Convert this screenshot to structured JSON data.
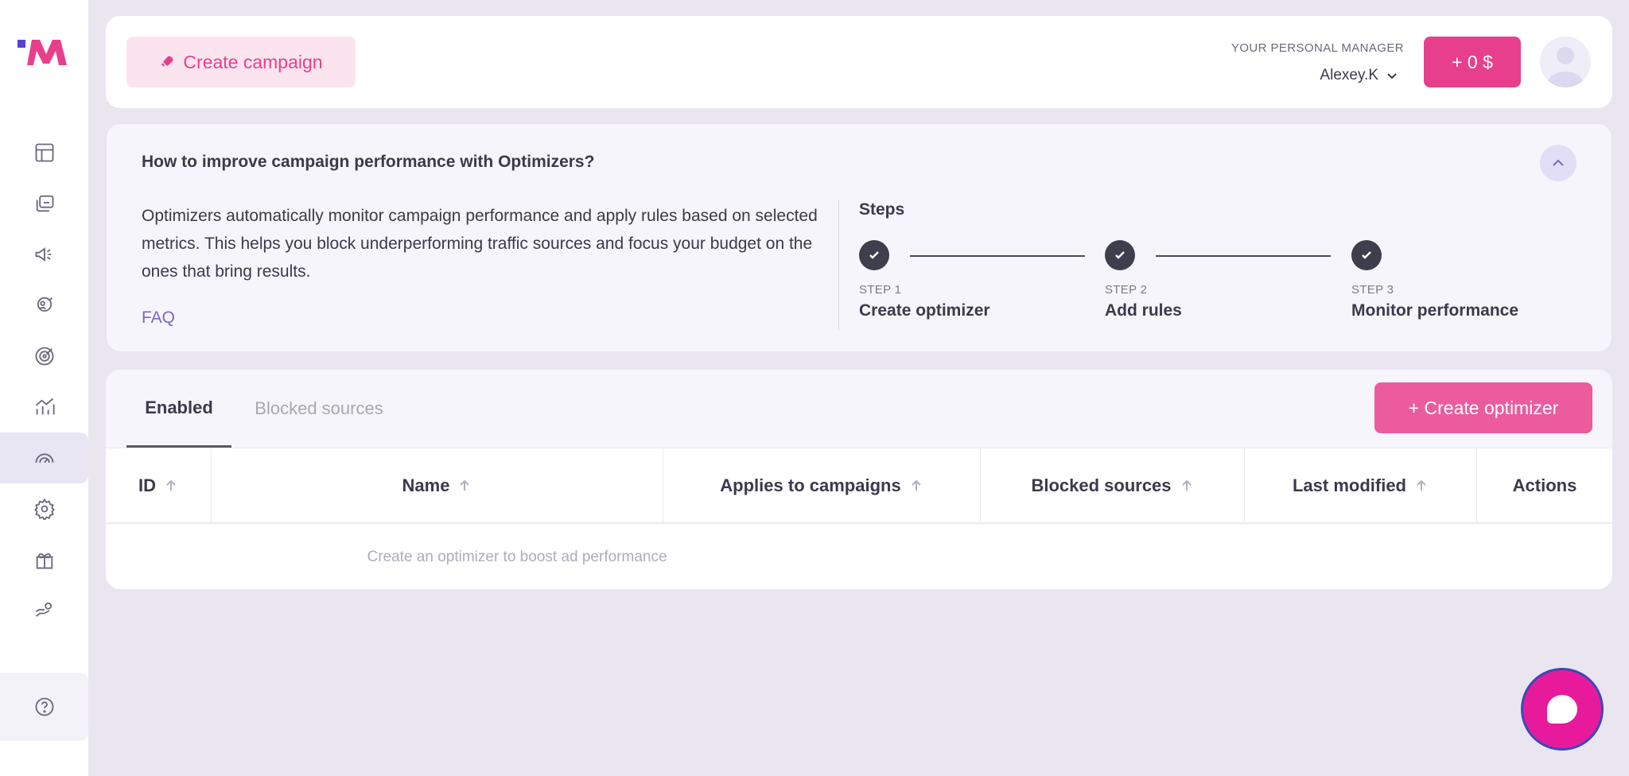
{
  "header": {
    "create_campaign_label": "Create campaign",
    "manager_label": "YOUR PERSONAL MANAGER",
    "manager_name": "Alexey.K",
    "balance_label": "+ 0 $"
  },
  "info": {
    "title": "How to improve campaign performance with Optimizers?",
    "description": "Optimizers automatically monitor campaign performance and apply rules based on selected metrics. This helps you block underperforming traffic sources and focus your budget on the ones that bring results.",
    "faq_label": "FAQ",
    "steps_title": "Steps",
    "steps": [
      {
        "num": "STEP 1",
        "label": "Create optimizer"
      },
      {
        "num": "STEP 2",
        "label": "Add rules"
      },
      {
        "num": "STEP 3",
        "label": "Monitor performance"
      }
    ]
  },
  "table": {
    "tabs": [
      {
        "label": "Enabled",
        "active": true
      },
      {
        "label": "Blocked sources",
        "active": false
      }
    ],
    "create_optimizer_label": "+ Create optimizer",
    "columns": [
      "ID",
      "Name",
      "Applies to campaigns",
      "Blocked sources",
      "Last modified",
      "Actions"
    ],
    "empty_message": "Create an optimizer to boost ad performance"
  },
  "colors": {
    "accent_pink": "#e83f8c",
    "accent_purple": "#7a66c9",
    "background": "#e9e6f0"
  }
}
